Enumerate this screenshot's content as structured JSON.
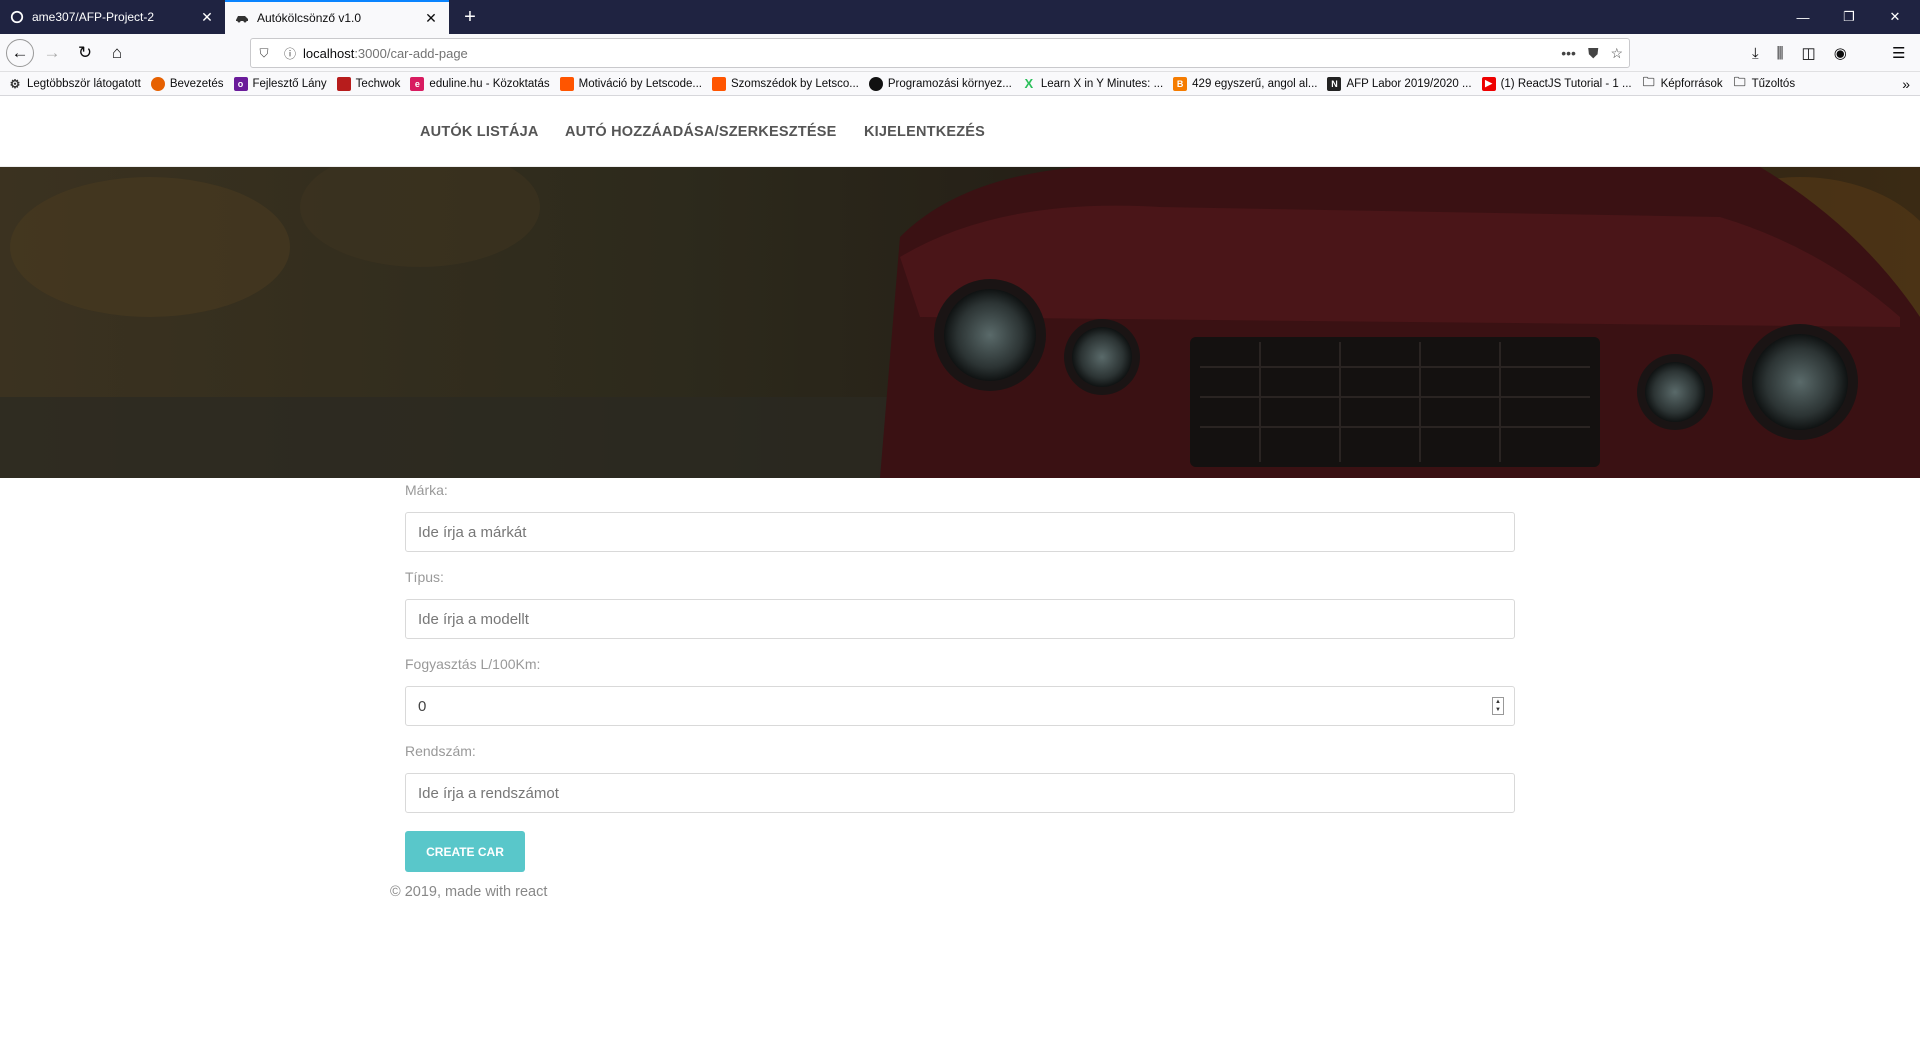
{
  "browser": {
    "tabs": [
      {
        "title": "ame307/AFP-Project-2",
        "icon": "github-icon"
      },
      {
        "title": "Autókölcsönző v1.0",
        "icon": "car-icon"
      }
    ],
    "url_host": "localhost",
    "url_path": ":3000/car-add-page",
    "bookmarks": [
      "Legtöbbször látogatott",
      "Bevezetés",
      "Fejlesztő Lány",
      "Techwok",
      "eduline.hu - Közoktatás",
      "Motiváció by Letscode...",
      "Szomszédok by Letsco...",
      "Programozási környez...",
      "Learn X in Y Minutes: ...",
      "429 egyszerű, angol al...",
      "AFP Labor 2019/2020 ...",
      "(1) ReactJS Tutorial - 1 ...",
      "Képforrások",
      "Tűzoltós"
    ]
  },
  "nav": {
    "cars_list": "AUTÓK LISTÁJA",
    "add_edit": "AUTÓ HOZZÁADÁSA/SZERKESZTÉSE",
    "logout": "KIJELENTKEZÉS"
  },
  "form": {
    "brand_label": "Márka:",
    "brand_placeholder": "Ide írja a márkát",
    "type_label": "Típus:",
    "type_placeholder": "Ide írja a modellt",
    "consumption_label": "Fogyasztás L/100Km:",
    "consumption_value": "0",
    "plate_label": "Rendszám:",
    "plate_placeholder": "Ide írja a rendszámot",
    "submit_label": "CREATE CAR"
  },
  "footer": "© 2019, made with react",
  "colors": {
    "accent": "#59c7ca",
    "tabbar": "#1f2341"
  }
}
